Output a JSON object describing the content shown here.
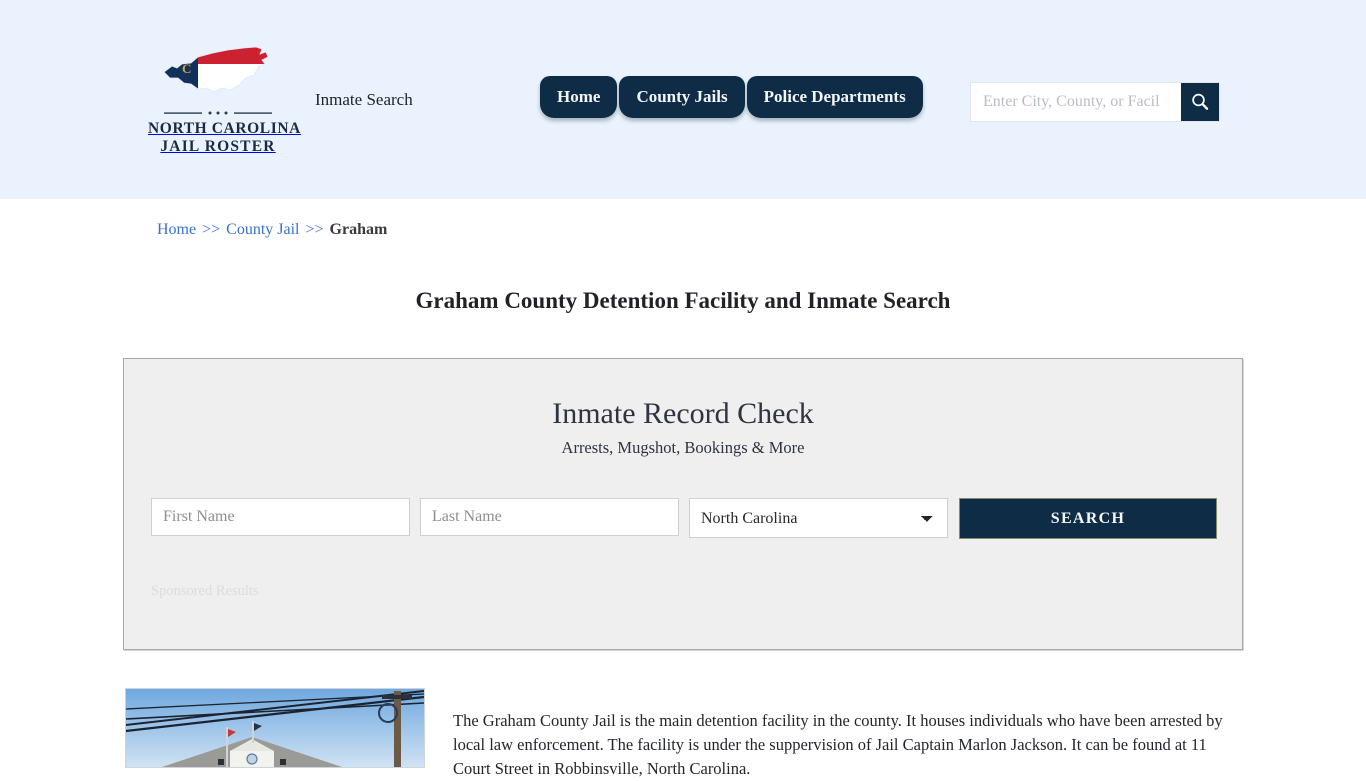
{
  "header": {
    "logo": {
      "line1": "NORTH CAROLINA",
      "line2": "JAIL ROSTER",
      "map_icon": "north-carolina-state-map-icon",
      "colors": {
        "navy": "#0e2c45",
        "red": "#cc2131",
        "gold": "#c8a63e"
      }
    },
    "tagline": "Inmate Search",
    "nav": [
      {
        "label": "Home",
        "name": "nav-home"
      },
      {
        "label": "County Jails",
        "name": "nav-county-jails"
      },
      {
        "label": "Police Departments",
        "name": "nav-police-departments"
      }
    ],
    "search": {
      "value": "",
      "placeholder": "Enter City, County, or Facil",
      "button_icon": "search-icon"
    },
    "background_color": "#eaf3fd"
  },
  "breadcrumb": {
    "home": "Home",
    "sep1": ">>",
    "county_jail": "County Jail",
    "sep2": ">>",
    "current": "Graham"
  },
  "page": {
    "title": "Graham County Detention Facility and Inmate Search"
  },
  "record_panel": {
    "title": "Inmate Record Check",
    "subtitle": "Arrests, Mugshot, Bookings & More",
    "first_name": {
      "value": "",
      "placeholder": "First Name"
    },
    "last_name": {
      "value": "",
      "placeholder": "Last Name"
    },
    "state": {
      "selected": "North Carolina",
      "options": [
        "North Carolina"
      ]
    },
    "submit_label": "SEARCH",
    "sponsored_label": "Sponsored Results",
    "accent_color": "#0e2c45"
  },
  "facility": {
    "photo_alt": "graham-county-courthouse-photo",
    "description": "The Graham County Jail is the main detention facility in the county. It houses individuals who have been arrested by local law enforcement. The facility is under the suppervision of Jail Captain Marlon Jackson. It can be found at 11 Court Street in Robbinsville, North Carolina."
  }
}
